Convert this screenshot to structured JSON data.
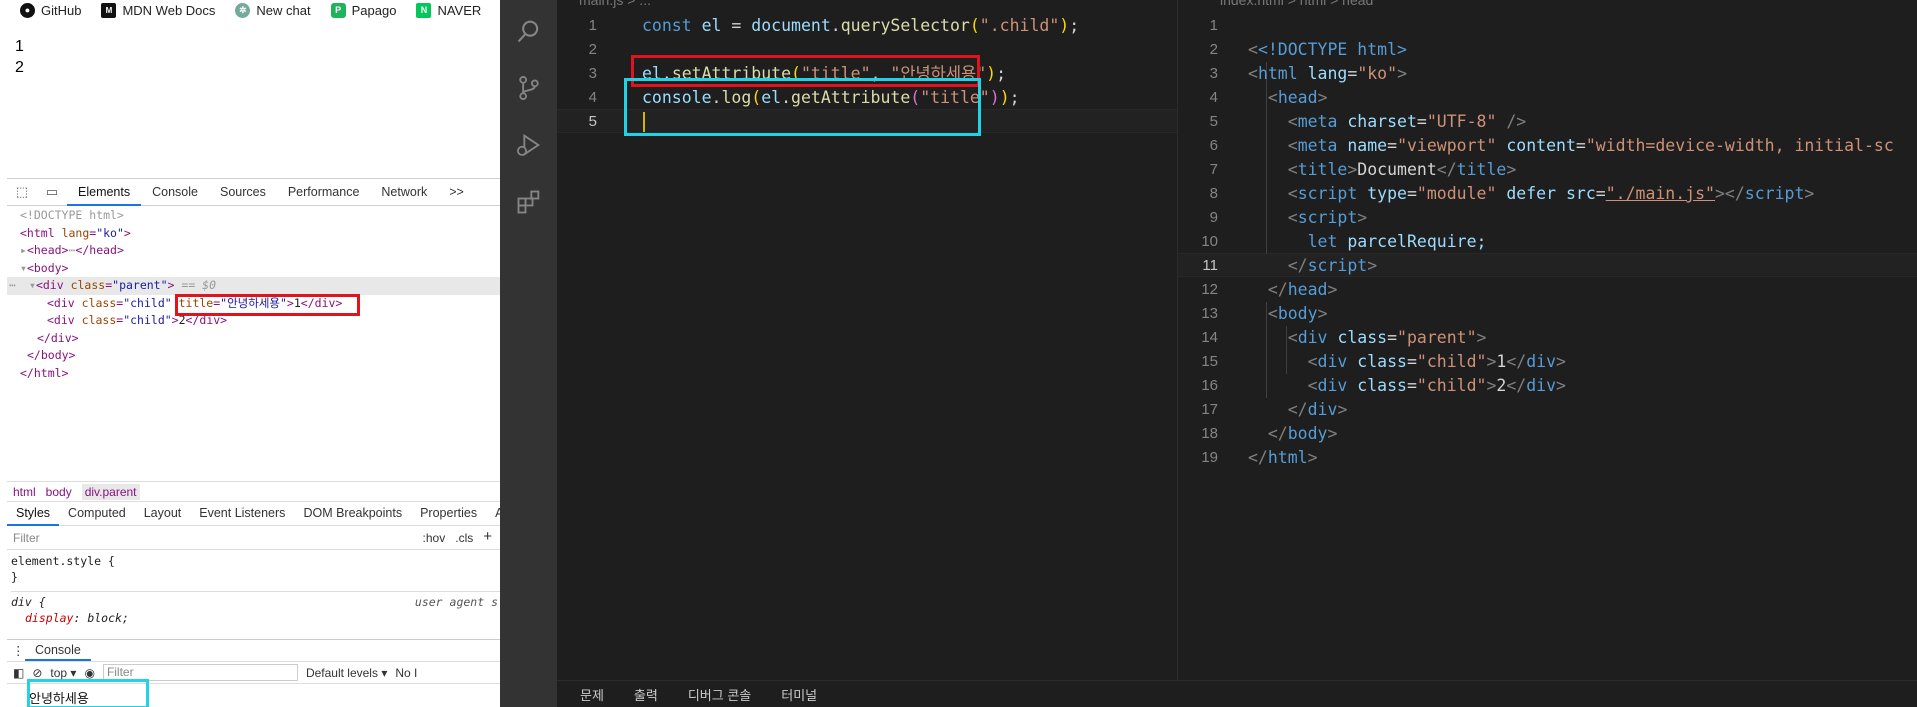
{
  "bookmarks": [
    {
      "label": "GitHub",
      "icon": "github-icon",
      "color": "#111111"
    },
    {
      "label": "MDN Web Docs",
      "icon": "mdn-icon",
      "color": "#111111"
    },
    {
      "label": "New chat",
      "icon": "openai-icon",
      "color": "#74aa9c"
    },
    {
      "label": "Papago",
      "icon": "papago-icon",
      "color": "#1fb35a"
    },
    {
      "label": "NAVER",
      "icon": "naver-icon",
      "color": "#03c75a"
    }
  ],
  "page": {
    "lines": [
      "1",
      "2"
    ]
  },
  "devtools": {
    "tabs": [
      "Elements",
      "Console",
      "Sources",
      "Performance",
      "Network",
      ">>"
    ],
    "dom": {
      "doctype": "<!DOCTYPE html>",
      "html_open": "<html",
      "lang_attr": "lang",
      "lang_val": "\"ko\"",
      "head": "<head>",
      "head_ellipsis": "⋯",
      "head_close": "</head>",
      "body_open": "<body>",
      "div_parent_open": "<div",
      "class_attr": "class",
      "parent_val": "\"parent\"",
      "selected_marker": "== $0",
      "child_val": "\"child\"",
      "title_attr": "title",
      "title_val": "\"안녕하세용\"",
      "child1_text": "1",
      "child2_text": "2",
      "div_close": "</div>",
      "body_close": "</body>",
      "html_close": "</html>"
    },
    "breadcrumbs": [
      "html",
      "body",
      "div.parent"
    ],
    "styles_tabs": [
      "Styles",
      "Computed",
      "Layout",
      "Event Listeners",
      "DOM Breakpoints",
      "Properties",
      "Acc"
    ],
    "filter_placeholder": "Filter",
    "hov": ":hov",
    "cls": ".cls",
    "rules": {
      "element_style": "element.style {",
      "close": "}",
      "div_selector": "div {",
      "user_agent": "user agent s",
      "display_prop": "display",
      "display_val": "block;"
    },
    "drawer_tab": "Console",
    "console": {
      "context": "top",
      "filter_placeholder": "Filter",
      "levels": "Default levels",
      "issues": "No I",
      "output": "안녕하세용"
    }
  },
  "vscode": {
    "left_tab": "main.js > ...",
    "right_tab": "index.html > html > head",
    "left_line_numbers": [
      "1",
      "2",
      "3",
      "4",
      "5"
    ],
    "left_code": {
      "l1_kw": "const",
      "l1_var": "el",
      "l1_eq": " = ",
      "l1_obj": "document",
      "l1_fn": "querySelector",
      "l1_str": "\".child\"",
      "l3_obj": "el",
      "l3_fn": "setAttribute",
      "l3_s1": "\"title\"",
      "l3_s2": "\"안녕하세용\"",
      "l4_obj": "console",
      "l4_fn": "log",
      "l4_obj2": "el",
      "l4_fn2": "getAttribute",
      "l4_s1": "\"title\""
    },
    "right_line_numbers": [
      "1",
      "2",
      "3",
      "4",
      "5",
      "6",
      "7",
      "8",
      "9",
      "10",
      "11",
      "12",
      "13",
      "14",
      "15",
      "16",
      "17",
      "18",
      "19"
    ],
    "right_code": {
      "doctype": "<!DOCTYPE html>",
      "meta_charset_val": "\"UTF-8\"",
      "meta_viewport_val": "\"width=device-width, initial-sc",
      "title_text": "Document",
      "script_type_val": "\"module\"",
      "script_src_val": "\"./main.js\"",
      "let_kw": "let",
      "parcel": "parcelRequire;",
      "parent_val": "\"parent\"",
      "child_val": "\"child\""
    },
    "panel_tabs": [
      "문제",
      "출력",
      "디버그 콘솔",
      "터미널"
    ]
  }
}
